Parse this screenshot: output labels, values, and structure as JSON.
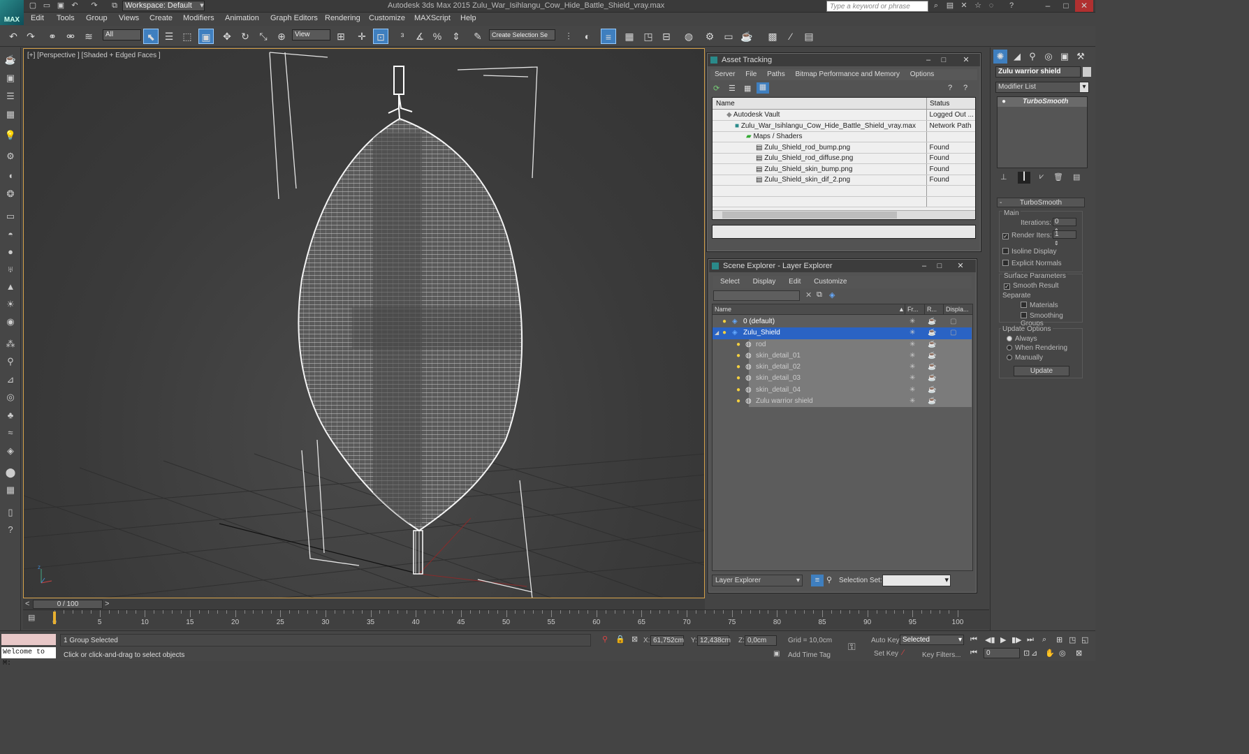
{
  "titlebar": {
    "logo": "MAX",
    "workspace": "Workspace: Default",
    "title": "Autodesk 3ds Max  2015    Zulu_War_Isihlangu_Cow_Hide_Battle_Shield_vray.max",
    "search_placeholder": "Type a keyword or phrase"
  },
  "menu": [
    "Edit",
    "Tools",
    "Group",
    "Views",
    "Create",
    "Modifiers",
    "Animation",
    "Graph Editors",
    "Rendering",
    "Customize",
    "MAXScript",
    "Help"
  ],
  "toolbar": {
    "filter_dropdown": "All",
    "refcoord_dropdown": "View",
    "selection_set": "Create Selection Se"
  },
  "viewport": {
    "label": "[+] [Perspective ] [Shaded + Edged Faces ]"
  },
  "asset_tracking": {
    "title": "Asset Tracking",
    "menu": [
      "Server",
      "File",
      "Paths",
      "Bitmap Performance and Memory",
      "Options"
    ],
    "col_name": "Name",
    "col_status": "Status",
    "rows": [
      {
        "name": "Autodesk Vault",
        "status": "Logged Out ...",
        "indent": 1
      },
      {
        "name": "Zulu_War_Isihlangu_Cow_Hide_Battle_Shield_vray.max",
        "status": "Network Path",
        "indent": 2
      },
      {
        "name": "Maps / Shaders",
        "status": "",
        "indent": 3
      },
      {
        "name": "Zulu_Shield_rod_bump.png",
        "status": "Found",
        "indent": 4
      },
      {
        "name": "Zulu_Shield_rod_diffuse.png",
        "status": "Found",
        "indent": 4
      },
      {
        "name": "Zulu_Shield_skin_bump.png",
        "status": "Found",
        "indent": 4
      },
      {
        "name": "Zulu_Shield_skin_dif_2.png",
        "status": "Found",
        "indent": 4
      }
    ]
  },
  "scene_explorer": {
    "title": "Scene Explorer - Layer Explorer",
    "menu": [
      "Select",
      "Display",
      "Edit",
      "Customize"
    ],
    "col_name": "Name",
    "col_fr": "Fr...",
    "col_r": "R...",
    "col_disp": "Displa...",
    "rows": [
      {
        "name": "0 (default)",
        "level": 0,
        "selected": false,
        "child": false
      },
      {
        "name": "Zulu_Shield",
        "level": 0,
        "selected": true,
        "child": false
      },
      {
        "name": "rod",
        "level": 1,
        "selected": false,
        "child": true
      },
      {
        "name": "skin_detail_01",
        "level": 1,
        "selected": false,
        "child": true
      },
      {
        "name": "skin_detail_02",
        "level": 1,
        "selected": false,
        "child": true
      },
      {
        "name": "skin_detail_03",
        "level": 1,
        "selected": false,
        "child": true
      },
      {
        "name": "skin_detail_04",
        "level": 1,
        "selected": false,
        "child": true
      },
      {
        "name": "Zulu warrior shield",
        "level": 1,
        "selected": false,
        "child": true
      }
    ],
    "footer_mode": "Layer Explorer",
    "selection_set_label": "Selection Set:"
  },
  "command_panel": {
    "object_name": "Zulu warrior shield",
    "modifier_list": "Modifier List",
    "stack_item": "TurboSmooth",
    "rollout_title": "TurboSmooth",
    "main_label": "Main",
    "iterations_label": "Iterations:",
    "iterations_value": "0",
    "render_iters_label": "Render Iters:",
    "render_iters_value": "1",
    "isoline": "Isoline Display",
    "explicit_normals": "Explicit Normals",
    "surface_params": "Surface Parameters",
    "smooth_result": "Smooth Result",
    "separate": "Separate",
    "materials": "Materials",
    "smoothing_groups": "Smoothing Groups",
    "update_options": "Update Options",
    "always": "Always",
    "when_rendering": "When Rendering",
    "manually": "Manually",
    "update_button": "Update"
  },
  "timeline": {
    "frame_label": "0 / 100",
    "ticks": [
      "0",
      "5",
      "10",
      "15",
      "20",
      "25",
      "30",
      "35",
      "40",
      "45",
      "50",
      "55",
      "60",
      "65",
      "70",
      "75",
      "80",
      "85",
      "90",
      "95",
      "100"
    ]
  },
  "status": {
    "welcome": "Welcome to M:",
    "selection": "1 Group Selected",
    "prompt": "Click or click-and-drag to select objects",
    "x_label": "X:",
    "x": "61,752cm",
    "y_label": "Y:",
    "y": "12,438cm",
    "z_label": "Z:",
    "z": "0,0cm",
    "grid": "Grid = 10,0cm",
    "add_time_tag": "Add Time Tag",
    "auto_key": "Auto Key",
    "set_key": "Set Key",
    "selected_dropdown": "Selected",
    "key_filters": "Key Filters...",
    "frame_value": "0"
  }
}
